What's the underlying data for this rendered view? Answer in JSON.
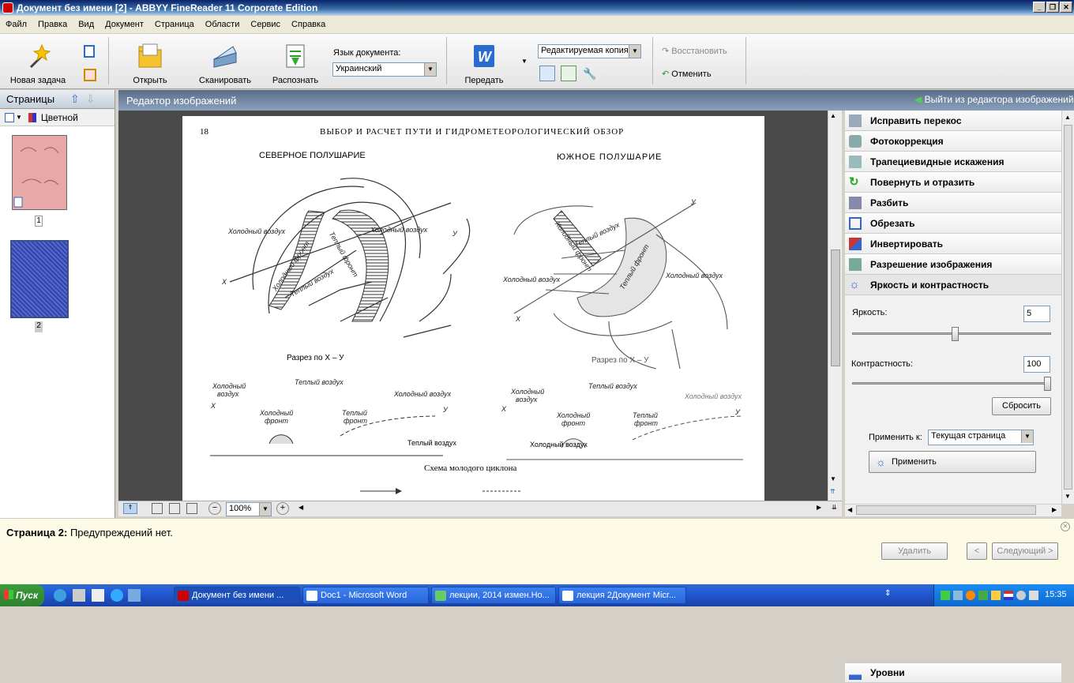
{
  "window": {
    "title": "Документ без имени [2] - ABBYY FineReader 11 Corporate Edition"
  },
  "menu": [
    "Файл",
    "Правка",
    "Вид",
    "Документ",
    "Страница",
    "Области",
    "Сервис",
    "Справка"
  ],
  "ribbon": {
    "new_task": "Новая задача",
    "open": "Открыть",
    "scan": "Сканировать",
    "recognize": "Распознать",
    "lang_label": "Язык документа:",
    "lang_value": "Украинский",
    "send": "Передать",
    "output_value": "Редактируемая копия",
    "restore": "Восстановить",
    "undo": "Отменить"
  },
  "pages": {
    "title": "Страницы",
    "color_mode": "Цветной",
    "items": [
      {
        "num": "1"
      },
      {
        "num": "2"
      }
    ]
  },
  "editor": {
    "title": "Редактор изображений",
    "exit": "Выйти из редактора изображений",
    "zoom": "100%"
  },
  "document": {
    "page_num": "18",
    "heading": "ВЫБОР И РАСЧЕТ ПУТИ И ГИДРОМЕТЕОРОЛОГИЧЕСКИЙ ОБЗОР",
    "north": "СЕВЕРНОЕ   ПОЛУШАРИЕ",
    "south": "ЮЖНОЕ ПОЛУШАРИЕ",
    "section_left": "Разрез по Х – У",
    "section_right": "Разрез по Х – У",
    "labels": {
      "cold_air": "Холодный воздух",
      "warm_air": "Теплый воздух",
      "cold_front": "Холодный фронт",
      "warm_front": "Теплый фронт",
      "x": "X",
      "y": "У",
      "front_l1": "Холодный",
      "front_l2": "фронт",
      "warm_front_l1": "Теплый",
      "warm_front_l2": "фронт",
      "air_l1": "Холодный",
      "air_l2": "воздух"
    },
    "legend_warm": "Теплый воздух",
    "legend_cold": "Холодный воздух",
    "caption": "Схема молодого циклона"
  },
  "tools": [
    {
      "label": "Исправить перекос",
      "icon": "skew-icon"
    },
    {
      "label": "Фотокоррекция",
      "icon": "camera-icon"
    },
    {
      "label": "Трапециевидные искажения",
      "icon": "trapezoid-icon"
    },
    {
      "label": "Повернуть и отразить",
      "icon": "rotate-icon"
    },
    {
      "label": "Разбить",
      "icon": "split-icon"
    },
    {
      "label": "Обрезать",
      "icon": "crop-icon"
    },
    {
      "label": "Инвертировать",
      "icon": "invert-icon"
    },
    {
      "label": "Разрешение изображения",
      "icon": "resolution-icon"
    },
    {
      "label": "Яркость и контрастность",
      "icon": "brightness-icon"
    }
  ],
  "brightness": {
    "label": "Яркость:",
    "value": "5",
    "level": 0.52
  },
  "contrast": {
    "label": "Контрастность:",
    "value": "100",
    "level": 1.0
  },
  "reset": "Сбросить",
  "apply_to_label": "Применить к:",
  "apply_to_value": "Текущая страница",
  "apply": "Применить",
  "levels": "Уровни",
  "warning": {
    "page": "Страница 2:",
    "text": "Предупреждений нет.",
    "delete": "Удалить",
    "prev": "<",
    "next": "Следующий >"
  },
  "taskbar": {
    "start": "Пуск",
    "items": [
      "Документ без имени ...",
      "Doc1 - Microsoft Word",
      "лекции, 2014 измен.Но...",
      "лекция 2Документ Micr..."
    ],
    "clock": "15:35"
  }
}
